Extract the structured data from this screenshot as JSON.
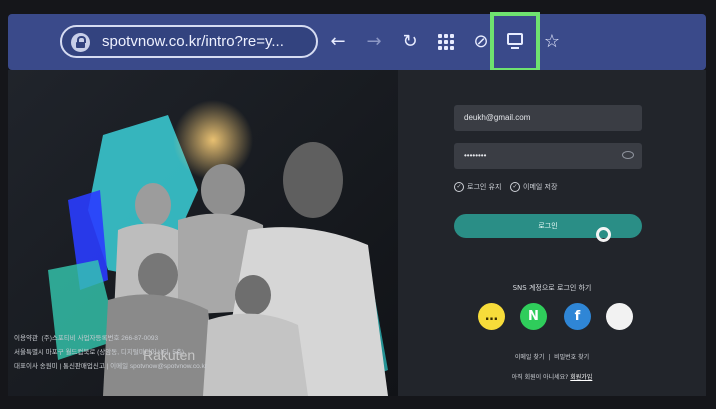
{
  "browser": {
    "url": "spotvnow.co.kr/intro?re=y...",
    "toolbar_icons": [
      "lock-icon",
      "back-arrow-icon",
      "forward-arrow-icon",
      "reload-icon",
      "apps-grid-icon",
      "eye-off-icon",
      "desktop-icon",
      "star-icon"
    ],
    "icons": {
      "back": "←",
      "forward": "→",
      "reload": "↻",
      "eye_off": "⊘",
      "star": "☆"
    },
    "colors": {
      "toolbar": "#3a4a8a",
      "highlight": "#6fe36f"
    }
  },
  "login": {
    "email_value": "deukh@gmail.com",
    "password_value": "••••••••",
    "keep_login_label": "로그인 유지",
    "save_email_label": "이메일 저장",
    "login_button": "로그인",
    "sns_title": "SNS 계정으로 로그인 하기",
    "sns_buttons": [
      {
        "name": "kakao",
        "glyph": "…",
        "color": "#f7dc3a"
      },
      {
        "name": "naver",
        "glyph": "N",
        "color": "#2fcd5b"
      },
      {
        "name": "facebook",
        "glyph": "f",
        "color": "#2f86d6"
      },
      {
        "name": "apple",
        "glyph": "",
        "color": "#f2f2f2"
      }
    ],
    "find_email": "이메일 찾기",
    "separator": "|",
    "find_password": "비밀번호 찾기",
    "not_member": "아직 회원이 아니세요?",
    "signup": "회원가입",
    "accent_color": "#2a8e86"
  },
  "hero": {
    "watermark": "Rakuten",
    "footer": {
      "terms": "이용약관",
      "company": "(주)스포티비 사업자등록번호 266-87-0093",
      "address": "서울특별시 마포구 월드컵북로 (상암동, 디지털미디어시티, 5층)",
      "ceo": "대표이사 송원미 | 통신판매업신고 | 이메일 spotvnow@spotvnow.co.kr"
    }
  }
}
